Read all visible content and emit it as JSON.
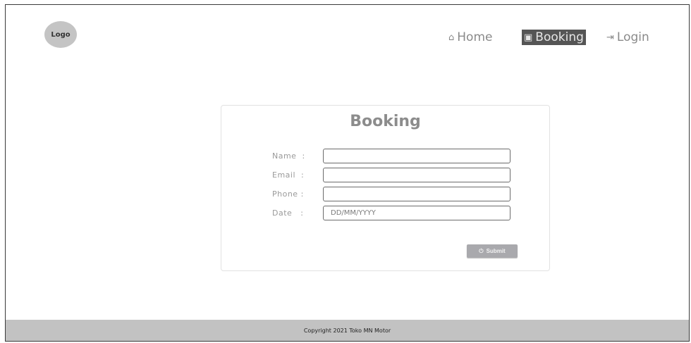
{
  "header": {
    "logo_text": "Logo",
    "nav": [
      {
        "label": "Home",
        "icon": "home-icon"
      },
      {
        "label": "Booking",
        "icon": "clipboard-icon",
        "active": true
      },
      {
        "label": "Login",
        "icon": "login-icon"
      }
    ]
  },
  "form": {
    "title": "Booking",
    "fields": [
      {
        "label": "Name  :",
        "value": "",
        "placeholder": ""
      },
      {
        "label": "Email  :",
        "value": "",
        "placeholder": ""
      },
      {
        "label": "Phone :",
        "value": "",
        "placeholder": ""
      },
      {
        "label": "Date   :",
        "value": "",
        "placeholder": "DD/MM/YYYY"
      }
    ],
    "submit_label": "Submit"
  },
  "footer": {
    "text": "Copyright 2021 Toko MN Motor"
  },
  "colors": {
    "active_nav_bg": "#555555",
    "footer_bg": "#c2c2c2",
    "submit_bg": "#a9a9ad"
  }
}
